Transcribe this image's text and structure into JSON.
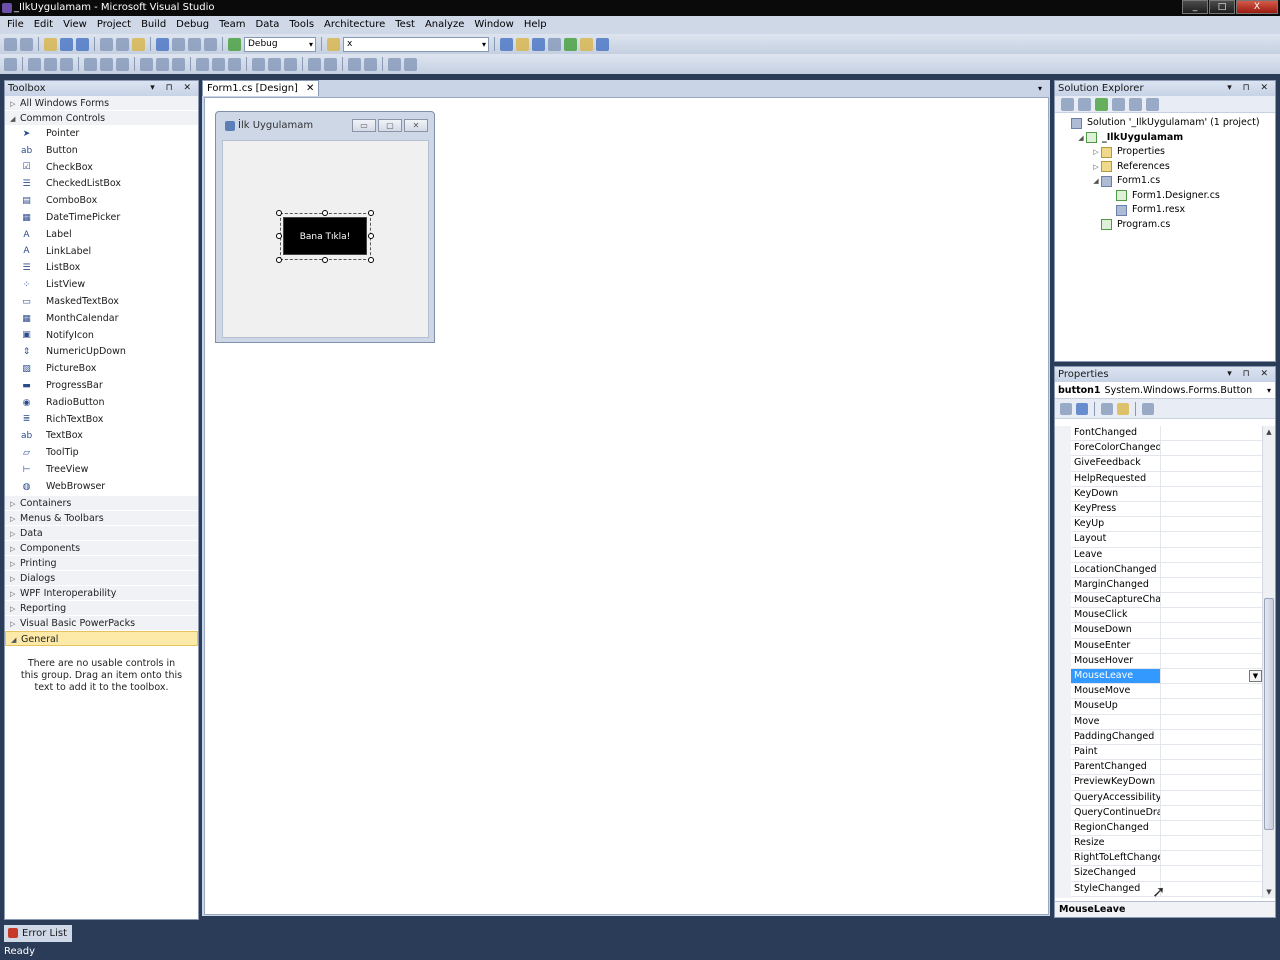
{
  "window": {
    "title": "_IlkUygulamam - Microsoft Visual Studio",
    "controls": [
      "_",
      "□",
      "X"
    ]
  },
  "menu": [
    "File",
    "Edit",
    "View",
    "Project",
    "Build",
    "Debug",
    "Team",
    "Data",
    "Tools",
    "Architecture",
    "Test",
    "Analyze",
    "Window",
    "Help"
  ],
  "toolbar": {
    "config": "Debug",
    "find": "x"
  },
  "toolbox": {
    "title": "Toolbox",
    "header_controls": "▾ ⊓ ✕",
    "groups_top": [
      {
        "label": "All Windows Forms",
        "expanded": false
      },
      {
        "label": "Common Controls",
        "expanded": true
      }
    ],
    "items": [
      {
        "label": "Pointer",
        "icon": "pointer-icon",
        "glyph": "➤"
      },
      {
        "label": "Button",
        "icon": "button-icon",
        "glyph": "ab"
      },
      {
        "label": "CheckBox",
        "icon": "checkbox-icon",
        "glyph": "☑"
      },
      {
        "label": "CheckedListBox",
        "icon": "checkedlistbox-icon",
        "glyph": "☰"
      },
      {
        "label": "ComboBox",
        "icon": "combobox-icon",
        "glyph": "▤"
      },
      {
        "label": "DateTimePicker",
        "icon": "datetimepicker-icon",
        "glyph": "▦"
      },
      {
        "label": "Label",
        "icon": "label-icon",
        "glyph": "A"
      },
      {
        "label": "LinkLabel",
        "icon": "linklabel-icon",
        "glyph": "A"
      },
      {
        "label": "ListBox",
        "icon": "listbox-icon",
        "glyph": "☰"
      },
      {
        "label": "ListView",
        "icon": "listview-icon",
        "glyph": "⁘"
      },
      {
        "label": "MaskedTextBox",
        "icon": "maskedtextbox-icon",
        "glyph": "▭"
      },
      {
        "label": "MonthCalendar",
        "icon": "monthcalendar-icon",
        "glyph": "▦"
      },
      {
        "label": "NotifyIcon",
        "icon": "notifyicon-icon",
        "glyph": "▣"
      },
      {
        "label": "NumericUpDown",
        "icon": "numericupdown-icon",
        "glyph": "⇕"
      },
      {
        "label": "PictureBox",
        "icon": "picturebox-icon",
        "glyph": "▨"
      },
      {
        "label": "ProgressBar",
        "icon": "progressbar-icon",
        "glyph": "▬"
      },
      {
        "label": "RadioButton",
        "icon": "radiobutton-icon",
        "glyph": "◉"
      },
      {
        "label": "RichTextBox",
        "icon": "richtextbox-icon",
        "glyph": "≣"
      },
      {
        "label": "TextBox",
        "icon": "textbox-icon",
        "glyph": "ab"
      },
      {
        "label": "ToolTip",
        "icon": "tooltip-icon",
        "glyph": "▱"
      },
      {
        "label": "TreeView",
        "icon": "treeview-icon",
        "glyph": "⊢"
      },
      {
        "label": "WebBrowser",
        "icon": "webbrowser-icon",
        "glyph": "◍"
      }
    ],
    "groups_bottom": [
      "Containers",
      "Menus & Toolbars",
      "Data",
      "Components",
      "Printing",
      "Dialogs",
      "WPF Interoperability",
      "Reporting",
      "Visual Basic PowerPacks"
    ],
    "general": "General",
    "empty_message": "There are no usable controls in this group. Drag an item onto this text to add it to the toolbox."
  },
  "document": {
    "tab_label": "Form1.cs [Design]",
    "close": "✕"
  },
  "form": {
    "title": "İlk Uygulamam",
    "button_text": "Bana Tıkla!"
  },
  "solution_explorer": {
    "title": "Solution Explorer",
    "header_controls": "▾ ⊓ ✕",
    "tree": [
      {
        "label": "Solution '_IlkUygulamam' (1 project)",
        "indent": 0,
        "exp": "",
        "icon": "solution-icon",
        "cls": "tic"
      },
      {
        "label": "_IlkUygulamam",
        "indent": 1,
        "exp": "◢",
        "icon": "project-icon",
        "cls": "tic cs",
        "bold": true
      },
      {
        "label": "Properties",
        "indent": 2,
        "exp": "▷",
        "icon": "properties-folder-icon",
        "cls": "tic fold"
      },
      {
        "label": "References",
        "indent": 2,
        "exp": "▷",
        "icon": "references-icon",
        "cls": "tic fold"
      },
      {
        "label": "Form1.cs",
        "indent": 2,
        "exp": "◢",
        "icon": "form-icon",
        "cls": "tic"
      },
      {
        "label": "Form1.Designer.cs",
        "indent": 3,
        "exp": "",
        "icon": "cs-file-icon",
        "cls": "tic cs"
      },
      {
        "label": "Form1.resx",
        "indent": 3,
        "exp": "",
        "icon": "resx-file-icon",
        "cls": "tic"
      },
      {
        "label": "Program.cs",
        "indent": 2,
        "exp": "",
        "icon": "cs-file-icon",
        "cls": "tic cs"
      }
    ]
  },
  "properties": {
    "title": "Properties",
    "header_controls": "▾ ⊓ ✕",
    "object_name": "button1",
    "object_type": "System.Windows.Forms.Button",
    "events": [
      "FontChanged",
      "ForeColorChanged",
      "GiveFeedback",
      "HelpRequested",
      "KeyDown",
      "KeyPress",
      "KeyUp",
      "Layout",
      "Leave",
      "LocationChanged",
      "MarginChanged",
      "MouseCaptureChan",
      "MouseClick",
      "MouseDown",
      "MouseEnter",
      "MouseHover",
      "MouseLeave",
      "MouseMove",
      "MouseUp",
      "Move",
      "PaddingChanged",
      "Paint",
      "ParentChanged",
      "PreviewKeyDown",
      "QueryAccessibilityH",
      "QueryContinueDrag",
      "RegionChanged",
      "Resize",
      "RightToLeftChange",
      "SizeChanged",
      "StyleChanged"
    ],
    "selected": "MouseLeave",
    "description": "MouseLeave"
  },
  "error_list": "Error List",
  "status": "Ready"
}
